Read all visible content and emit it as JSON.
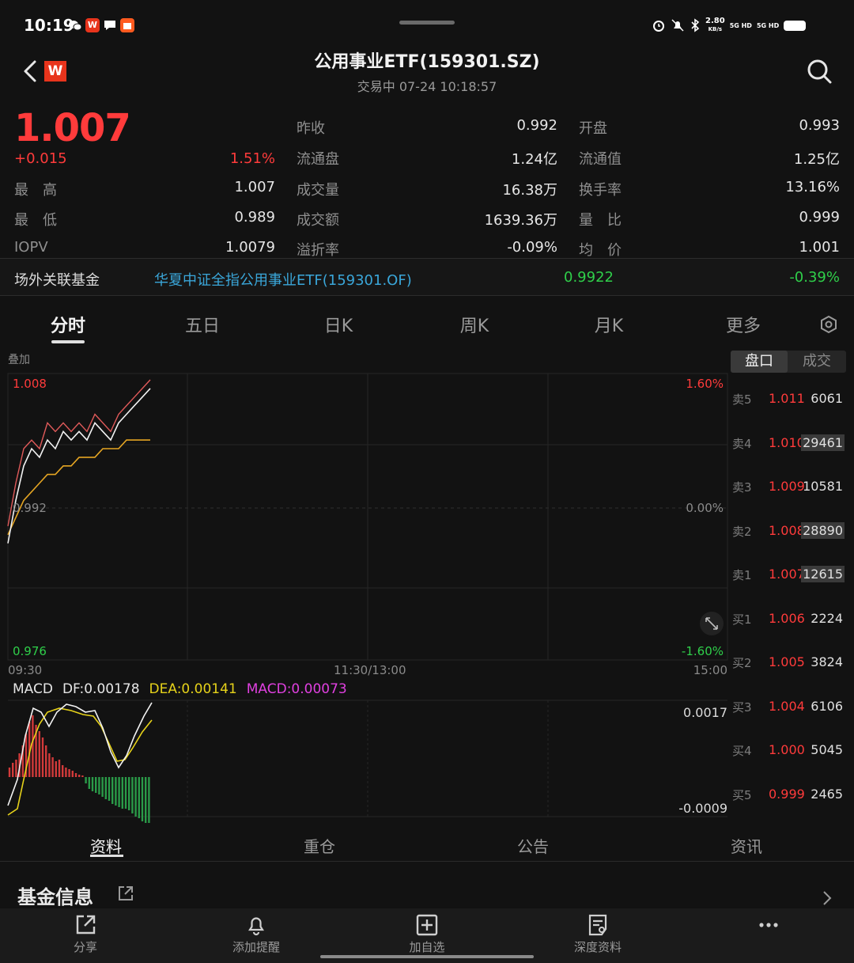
{
  "status_bar": {
    "time": "10:19",
    "net_speed_value": "2.80",
    "net_speed_unit": "KB/s",
    "signal_1": "5G HD",
    "signal_2": "5G HD"
  },
  "header": {
    "logo_text": "W",
    "title": "公用事业ETF(159301.SZ)",
    "subtitle": "交易中 07-24 10:18:57"
  },
  "quote": {
    "price": "1.007",
    "change": "+0.015",
    "change_pct": "1.51%",
    "rows": [
      {
        "l1": "最　高",
        "v1": "1.007",
        "l2": "成交量",
        "v2": "16.38万",
        "l3": "换手率",
        "v3": "13.16%"
      },
      {
        "l1": "最　低",
        "v1": "0.989",
        "l2": "成交额",
        "v2": "1639.36万",
        "l3": "量　比",
        "v3": "0.999"
      },
      {
        "l1": "IOPV",
        "v1": "1.0079",
        "l2": "溢折率",
        "v2": "-0.09%",
        "l3": "均　价",
        "v3": "1.001"
      }
    ],
    "top_rows": [
      {
        "l2": "昨收",
        "v2": "0.992",
        "l3": "开盘",
        "v3": "0.993"
      },
      {
        "l2": "流通盘",
        "v2": "1.24亿",
        "l3": "流通值",
        "v3": "1.25亿"
      }
    ]
  },
  "fund_row": {
    "label": "场外关联基金",
    "name": "华夏中证全指公用事业ETF(159301.OF)",
    "nav": "0.9922",
    "change": "-0.39%"
  },
  "tabs": [
    "分时",
    "五日",
    "日K",
    "周K",
    "月K",
    "更多"
  ],
  "chart": {
    "overlay_label": "叠加",
    "price_high": "1.008",
    "price_mid": "0.992",
    "price_low": "0.976",
    "pct_high": "1.60%",
    "pct_mid": "0.00%",
    "pct_low": "-1.60%",
    "time_start": "09:30",
    "time_mid": "11:30/13:00",
    "time_end": "15:00"
  },
  "macd": {
    "name": "MACD",
    "df": "DF:0.00178",
    "dea": "DEA:0.00141",
    "macd": "MACD:0.00073",
    "axis_top": "0.0017",
    "axis_bottom": "-0.0009"
  },
  "order_book": {
    "tab_active": "盘口",
    "tab_other": "成交",
    "asks": [
      {
        "label": "卖5",
        "price": "1.011",
        "vol": "6061",
        "hl": false
      },
      {
        "label": "卖4",
        "price": "1.010",
        "vol": "29461",
        "hl": true
      },
      {
        "label": "卖3",
        "price": "1.009",
        "vol": "10581",
        "hl": false
      },
      {
        "label": "卖2",
        "price": "1.008",
        "vol": "28890",
        "hl": true
      },
      {
        "label": "卖1",
        "price": "1.007",
        "vol": "12615",
        "hl": true
      }
    ],
    "bids": [
      {
        "label": "买1",
        "price": "1.006",
        "vol": "2224",
        "hl": false
      },
      {
        "label": "买2",
        "price": "1.005",
        "vol": "3824",
        "hl": false
      },
      {
        "label": "买3",
        "price": "1.004",
        "vol": "6106",
        "hl": false
      },
      {
        "label": "买4",
        "price": "1.000",
        "vol": "5045",
        "hl": false
      },
      {
        "label": "买5",
        "price": "0.999",
        "vol": "2465",
        "hl": false
      }
    ]
  },
  "bottom_tabs": [
    "资料",
    "重仓",
    "公告",
    "资讯"
  ],
  "fund_info": {
    "title": "基金信息"
  },
  "nav": [
    {
      "label": "分享",
      "icon": "share-icon"
    },
    {
      "label": "添加提醒",
      "icon": "bell-icon"
    },
    {
      "label": "加自选",
      "icon": "add-watchlist-icon"
    },
    {
      "label": "深度资料",
      "icon": "report-icon"
    }
  ],
  "chart_data": {
    "type": "line",
    "price_axis": [
      0.976,
      1.008
    ],
    "reference_price": 0.992,
    "series": [
      {
        "values": [
          0.989,
          0.994,
          0.998,
          1.0,
          0.999,
          1.001,
          1.0,
          1.002,
          1.001,
          1.002,
          1.001,
          1.003,
          1.002,
          1.001,
          1.003,
          1.004,
          1.005,
          1.006,
          1.007
        ]
      },
      {
        "values": [
          0.99,
          0.992,
          0.994,
          0.995,
          0.996,
          0.997,
          0.997,
          0.998,
          0.998,
          0.999,
          0.999,
          0.999,
          1.0,
          1.0,
          1.0,
          1.001,
          1.001,
          1.001,
          1.001
        ]
      },
      {
        "values": [
          0.991,
          0.996,
          1.0,
          1.001,
          1.0,
          1.003,
          1.002,
          1.003,
          1.002,
          1.003,
          1.002,
          1.004,
          1.003,
          1.002,
          1.004,
          1.005,
          1.006,
          1.007,
          1.008
        ]
      }
    ]
  }
}
